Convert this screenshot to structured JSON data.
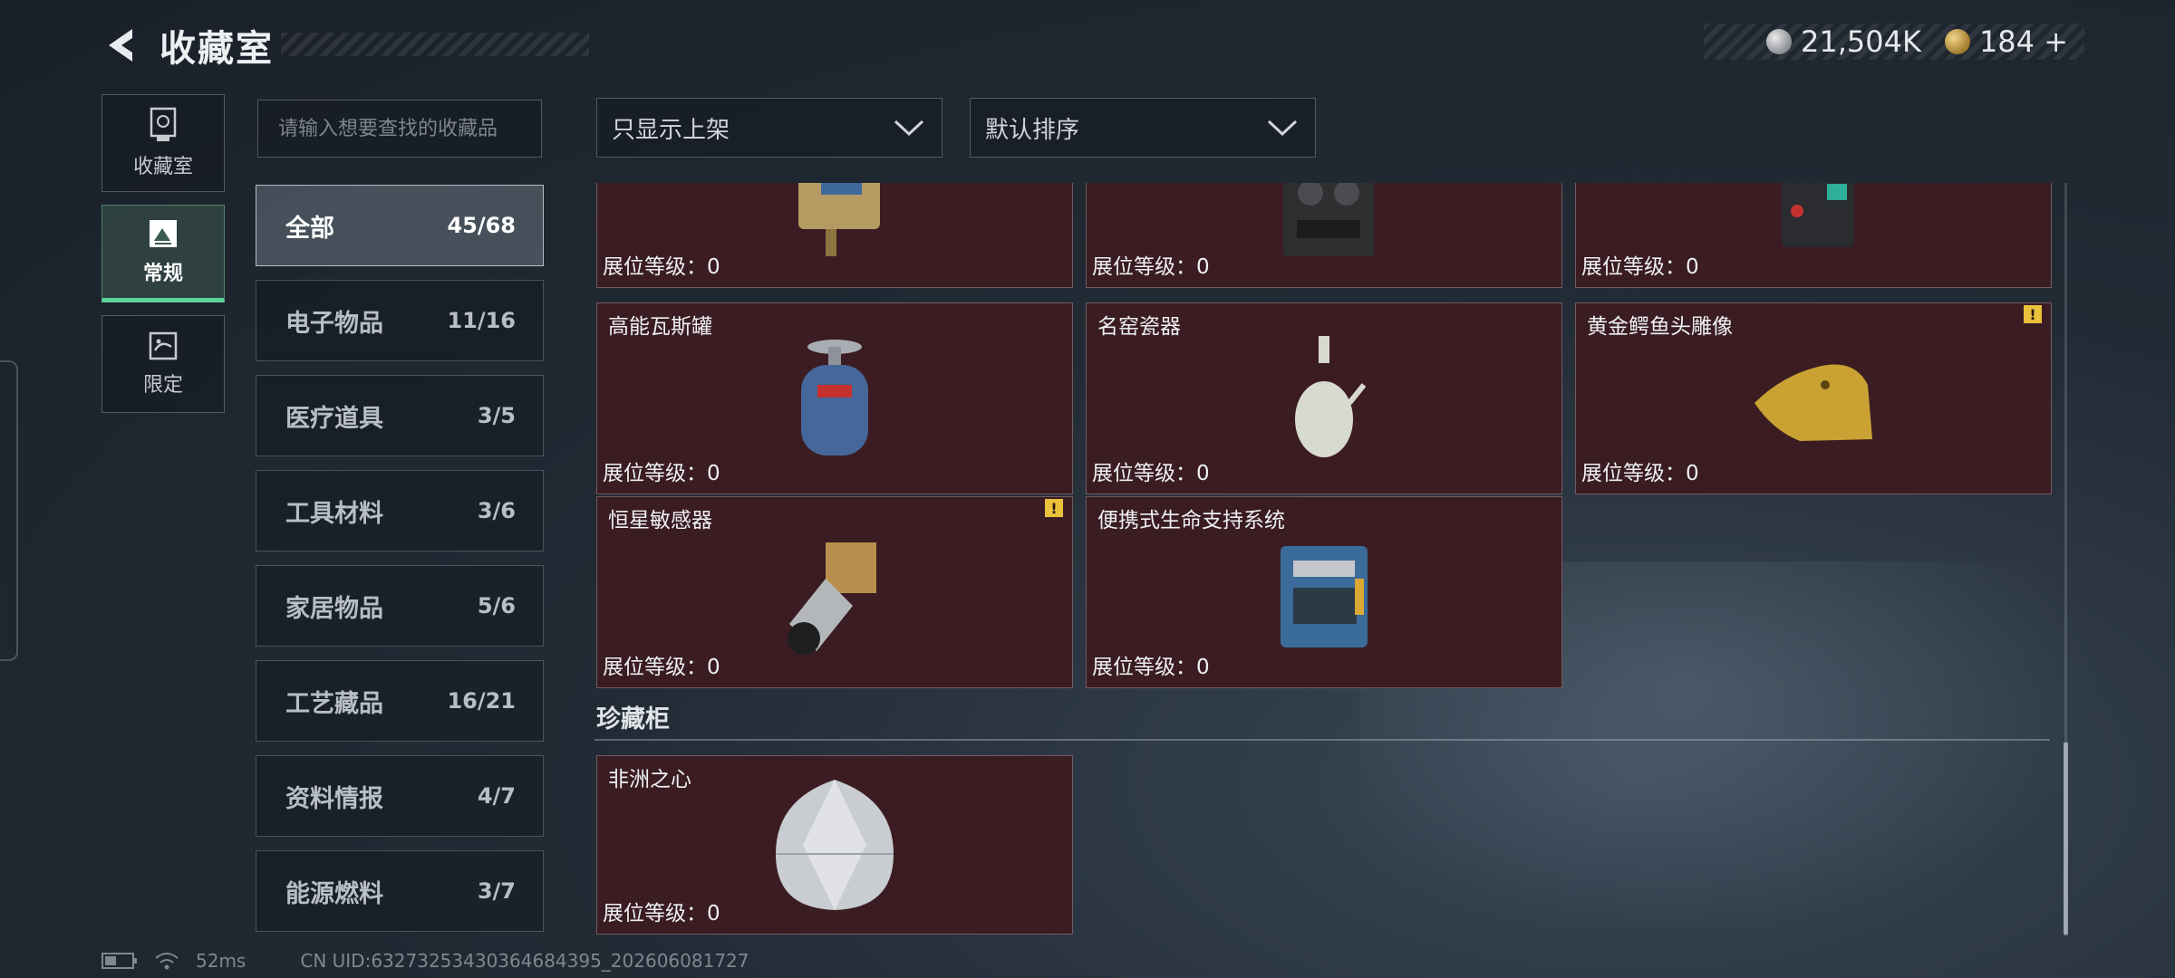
{
  "header": {
    "title": "收藏室"
  },
  "currency": [
    {
      "icon": "silver-coin-icon",
      "value": "21,504K"
    },
    {
      "icon": "gold-coin-icon",
      "value": "184 +"
    }
  ],
  "sidenav": [
    {
      "label": "收藏室",
      "icon": "trophy-icon",
      "active": false
    },
    {
      "label": "常规",
      "icon": "picture-icon",
      "active": true
    },
    {
      "label": "限定",
      "icon": "map-icon",
      "active": false
    }
  ],
  "search": {
    "placeholder": "请输入想要查找的收藏品"
  },
  "categories": [
    {
      "name": "全部",
      "count": "45/68"
    },
    {
      "name": "电子物品",
      "count": "11/16"
    },
    {
      "name": "医疗道具",
      "count": "3/5"
    },
    {
      "name": "工具材料",
      "count": "3/6"
    },
    {
      "name": "家居物品",
      "count": "5/6"
    },
    {
      "name": "工艺藏品",
      "count": "16/21"
    },
    {
      "name": "资料情报",
      "count": "4/7"
    },
    {
      "name": "能源燃料",
      "count": "3/7"
    }
  ],
  "filters": {
    "shelf": "只显示上架",
    "sort": "默认排序"
  },
  "items": [
    {
      "name": "",
      "level_label": "展位等级：0"
    },
    {
      "name": "",
      "level_label": "展位等级：0"
    },
    {
      "name": "",
      "level_label": "展位等级：0"
    },
    {
      "name": "高能瓦斯罐",
      "level_label": "展位等级：0"
    },
    {
      "name": "名窑瓷器",
      "level_label": "展位等级：0"
    },
    {
      "name": "黄金鳄鱼头雕像",
      "level_label": "展位等级：0",
      "warning": "!"
    },
    {
      "name": "恒星敏感器",
      "level_label": "展位等级：0",
      "warning": "!"
    },
    {
      "name": "便携式生命支持系统",
      "level_label": "展位等级：0"
    }
  ],
  "treasure_section": {
    "title": "珍藏柜",
    "items": [
      {
        "name": "非洲之心",
        "level_label": "展位等级：0"
      }
    ]
  },
  "footer": {
    "ping": "52ms",
    "uid": "CN UID:632732534303646843​95_202606081727"
  }
}
